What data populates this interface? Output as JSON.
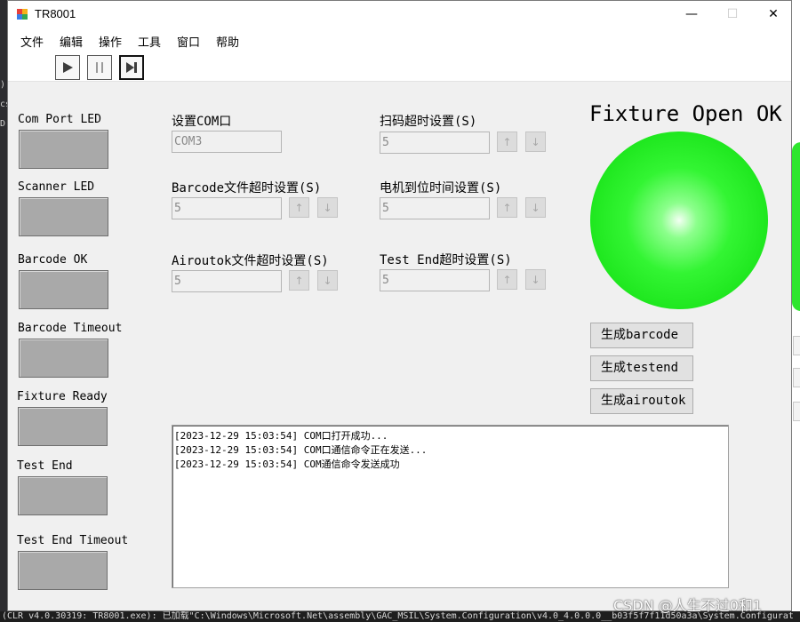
{
  "window": {
    "title": "TR8001"
  },
  "window_controls": {
    "minimize": "—",
    "maximize": "☐",
    "close": "✕"
  },
  "menu": [
    "文件",
    "编辑",
    "操作",
    "工具",
    "窗口",
    "帮助"
  ],
  "toolbar": {
    "icons": [
      "play-icon",
      "pause-icon",
      "step-forward-icon"
    ]
  },
  "leds": [
    {
      "label": "Com Port LED"
    },
    {
      "label": "Scanner LED"
    },
    {
      "label": "Barcode OK"
    },
    {
      "label": "Barcode Timeout"
    },
    {
      "label": "Fixture Ready"
    },
    {
      "label": "Test End"
    },
    {
      "label": "Test End Timeout"
    }
  ],
  "settings": {
    "com": {
      "label": "设置COM口",
      "value": "COM3"
    },
    "scan_timeout": {
      "label": "扫码超时设置(S)",
      "value": "5"
    },
    "barcode_file_timeout": {
      "label": "Barcode文件超时设置(S)",
      "value": "5"
    },
    "motor_time": {
      "label": "电机到位时间设置(S)",
      "value": "5"
    },
    "airoutok_file_timeout": {
      "label": "Airoutok文件超时设置(S)",
      "value": "5"
    },
    "test_end_timeout": {
      "label": "Test End超时设置(S)",
      "value": "5"
    },
    "spin_up": "↑",
    "spin_down": "↓"
  },
  "status": {
    "title": "Fixture Open OK",
    "color": "#1ee81e"
  },
  "buttons": {
    "gen_barcode": "生成barcode",
    "gen_testend": "生成testend",
    "gen_airoutok": "生成airoutok"
  },
  "log": [
    "[2023-12-29 15:03:54] COM口打开成功...",
    "[2023-12-29 15:03:54] COM口通信命令正在发送...",
    "[2023-12-29 15:03:54] COM通信命令发送成功"
  ],
  "background": {
    "bottom_text": "(CLR v4.0.30319: TR8001.exe): 已加载\"C:\\Windows\\Microsoft.Net\\assembly\\GAC_MSIL\\System.Configuration\\v4.0_4.0.0.0__b03f5f7f11d50a3a\\System.Configurat",
    "left_snippets": [
      ")",
      "cs",
      "D"
    ]
  },
  "watermark": "CSDN @人生不过0和1"
}
